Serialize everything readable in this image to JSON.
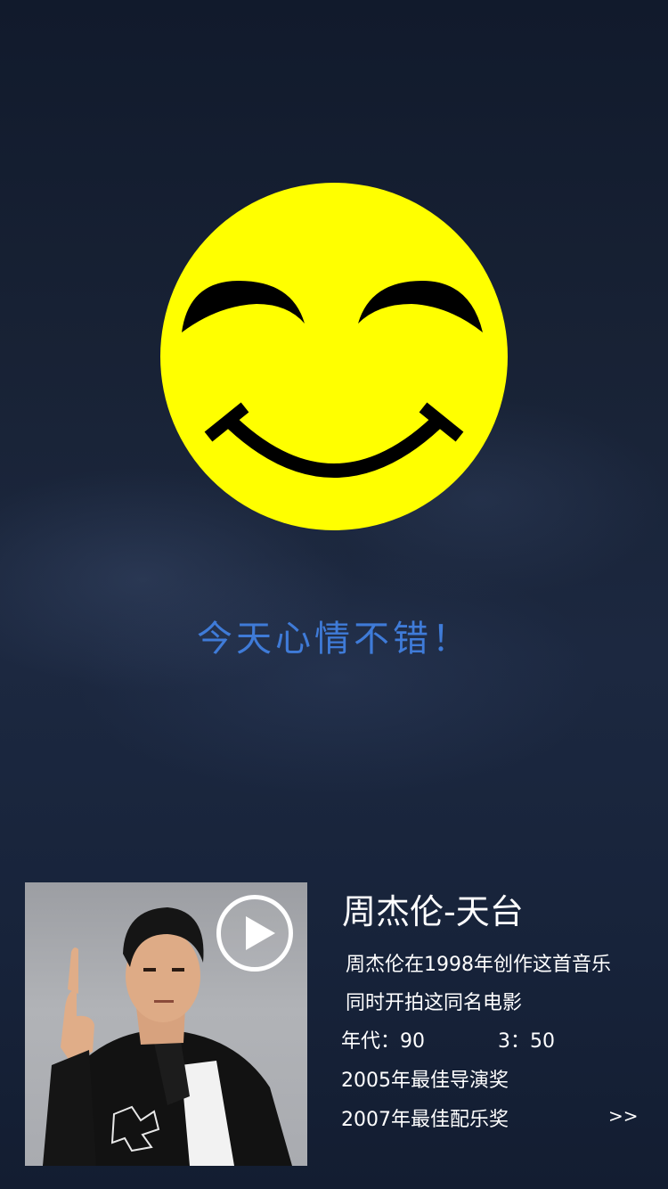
{
  "mood_text": "今天心情不错！",
  "song": {
    "title": "周杰伦-天台",
    "desc_line1": "周杰伦在1998年创作这首音乐",
    "desc_line2": "同时开拍这同名电影",
    "era_label": "年代：90",
    "duration": "3：50",
    "award1": "2005年最佳导演奖",
    "award2": "2007年最佳配乐奖",
    "more_link": ">>"
  },
  "colors": {
    "smiley_face": "#ffff00",
    "smiley_features": "#000000",
    "mood_text": "#3f7bd8",
    "background": "#1a2538"
  },
  "icons": {
    "play": "play-icon",
    "smiley": "smiley-icon"
  }
}
